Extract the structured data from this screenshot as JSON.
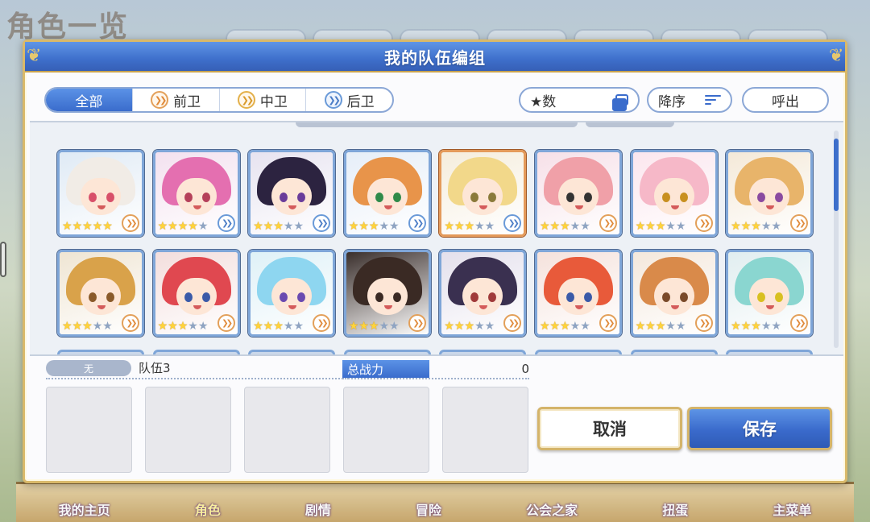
{
  "background": {
    "screen_title": "角色一览",
    "nav": [
      "我的主页",
      "角色",
      "剧情",
      "冒险",
      "公会之家",
      "扭蛋",
      "主菜单"
    ],
    "nav_active": 1
  },
  "dialog": {
    "title": "我的队伍编组",
    "filters": {
      "tabs": [
        {
          "label": "全部",
          "icon": "",
          "active": true
        },
        {
          "label": "前卫",
          "icon": "front-role-icon",
          "active": false
        },
        {
          "label": "中卫",
          "icon": "middle-role-icon",
          "active": false
        },
        {
          "label": "后卫",
          "icon": "back-role-icon",
          "active": false
        }
      ],
      "sort_key_label": "★数",
      "sort_order_label": "降序",
      "call_label": "呼出"
    },
    "characters": [
      {
        "stars": 5,
        "role": "front",
        "hair": "#f1ece6",
        "eyes": "#d8506a",
        "frame": "normal"
      },
      {
        "stars": 4,
        "role": "back",
        "hair": "#e46fb0",
        "eyes": "#b5405a",
        "frame": "normal"
      },
      {
        "stars": 3,
        "role": "back",
        "hair": "#2c2340",
        "eyes": "#6a3c9a",
        "frame": "normal"
      },
      {
        "stars": 3,
        "role": "back",
        "hair": "#e8944a",
        "eyes": "#2f8a4a",
        "frame": "normal"
      },
      {
        "stars": 3,
        "role": "back",
        "hair": "#f2d88a",
        "eyes": "#8a7a3a",
        "frame": "gold"
      },
      {
        "stars": 3,
        "role": "front",
        "hair": "#f0a0a8",
        "eyes": "#333333",
        "frame": "normal"
      },
      {
        "stars": 3,
        "role": "front",
        "hair": "#f6b8c8",
        "eyes": "#c89020",
        "frame": "normal"
      },
      {
        "stars": 3,
        "role": "front",
        "hair": "#e8b46a",
        "eyes": "#8a4aa0",
        "frame": "normal"
      },
      {
        "stars": 3,
        "role": "front",
        "hair": "#d9a24a",
        "eyes": "#8a5a2a",
        "frame": "normal"
      },
      {
        "stars": 3,
        "role": "front",
        "hair": "#e04850",
        "eyes": "#3a5aa8",
        "frame": "normal"
      },
      {
        "stars": 3,
        "role": "front",
        "hair": "#8ed6f0",
        "eyes": "#6a4ab0",
        "frame": "normal"
      },
      {
        "stars": 3,
        "role": "front",
        "hair": "#3a2a24",
        "eyes": "#3a2a24",
        "frame": "normal"
      },
      {
        "stars": 3,
        "role": "front",
        "hair": "#3a3050",
        "eyes": "#a03a3a",
        "frame": "normal"
      },
      {
        "stars": 3,
        "role": "front",
        "hair": "#e85a3a",
        "eyes": "#3a5aa8",
        "frame": "normal"
      },
      {
        "stars": 3,
        "role": "front",
        "hair": "#d98a4a",
        "eyes": "#7a4a2a",
        "frame": "normal"
      },
      {
        "stars": 3,
        "role": "front",
        "hair": "#8ad6d0",
        "eyes": "#d8c020",
        "frame": "normal"
      }
    ],
    "team": {
      "status_label": "无",
      "name": "队伍3",
      "power_label": "总战力",
      "power_value": "0",
      "slot_count": 5
    },
    "buttons": {
      "cancel": "取消",
      "save": "保存"
    }
  },
  "colors": {
    "accent": "#3a6ccc",
    "gold_border": "#d4b46a",
    "star": "#ffd33a"
  }
}
